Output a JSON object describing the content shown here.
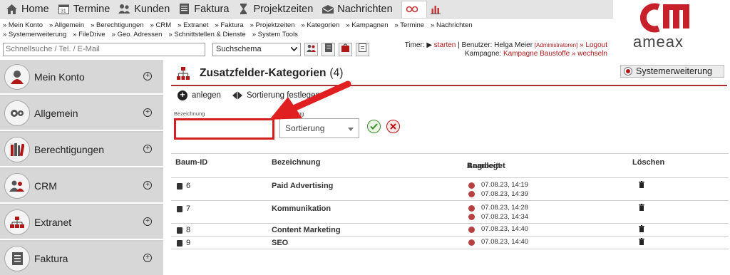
{
  "nav": {
    "tabs": [
      {
        "label": "Home",
        "icon": "home-icon"
      },
      {
        "label": "Termine",
        "icon": "calendar-icon"
      },
      {
        "label": "Kunden",
        "icon": "users-icon"
      },
      {
        "label": "Faktura",
        "icon": "document-icon"
      },
      {
        "label": "Projektzeiten",
        "icon": "timer-icon"
      },
      {
        "label": "Nachrichten",
        "icon": "mail-icon"
      }
    ],
    "extra_icons": [
      "settings-dots-icon",
      "bar-chart-icon"
    ]
  },
  "breadcrumbs": {
    "row1": [
      "» Mein Konto",
      "» Allgemein",
      "» Berechtigungen",
      "» CRM",
      "» Extranet",
      "» Faktura",
      "» Projektzeiten",
      "» Kategorien",
      "» Kampagnen",
      "» Termine",
      "» Nachrichten"
    ],
    "row2": [
      "» Systemerweiterung",
      "» FileDrive",
      "» Geo. Adressen",
      "» Schnittstellen & Dienste",
      "» System Tools"
    ]
  },
  "search": {
    "placeholder": "Schnellsuche / Tel. / E-Mail",
    "schema_value": "Suchschema"
  },
  "timer": {
    "prefix": "Timer:",
    "start": "starten",
    "user_text": "| Benutzer: Helga Meier",
    "role": "[Administratoren]",
    "logout": "» Logout",
    "campaign_label": "Kampagne:",
    "campaign": "Kampagne Baustoffe",
    "switch": "» wechseln"
  },
  "logo": {
    "text": "ameax"
  },
  "sidebar": {
    "items": [
      {
        "label": "Mein Konto",
        "icon": "user-icon"
      },
      {
        "label": "Allgemein",
        "icon": "gear-icon"
      },
      {
        "label": "Berechtigungen",
        "icon": "books-icon"
      },
      {
        "label": "CRM",
        "icon": "users-icon"
      },
      {
        "label": "Extranet",
        "icon": "network-icon"
      },
      {
        "label": "Faktura",
        "icon": "document-icon"
      }
    ]
  },
  "page": {
    "title": "Zusatzfelder-Kategorien",
    "count": "(4)",
    "system_button": "Systemerweiterung",
    "actions": {
      "create": "anlegen",
      "sort": "Sortierung festlegen"
    }
  },
  "form": {
    "label_bez": "Bezeichnung",
    "label_sort": "Sortierung",
    "bez_value": "",
    "sort_value": "Sortierung"
  },
  "table": {
    "headers": {
      "id": "Baum-ID",
      "bez": "Bezeichnung",
      "created": "Angelegt",
      "edited": "Bearbeitet",
      "delete": "Löschen"
    },
    "rows": [
      {
        "id": "6",
        "bez": "Paid Advertising",
        "created": "07.08.23, 14:19",
        "edited": "07.08.23, 14:39"
      },
      {
        "id": "7",
        "bez": "Kommunikation",
        "created": "07.08.23, 14:28",
        "edited": "07.08.23, 14:34"
      },
      {
        "id": "8",
        "bez": "Content Marketing",
        "created": "07.08.23, 14:40",
        "edited": ""
      },
      {
        "id": "9",
        "bez": "SEO",
        "created": "07.08.23, 14:40",
        "edited": ""
      }
    ]
  },
  "colors": {
    "accent": "#b01818",
    "highlight_box": "#d21f1f",
    "sidebar_bg": "#d7d7d7",
    "nav_bg": "#e4e4e4"
  }
}
